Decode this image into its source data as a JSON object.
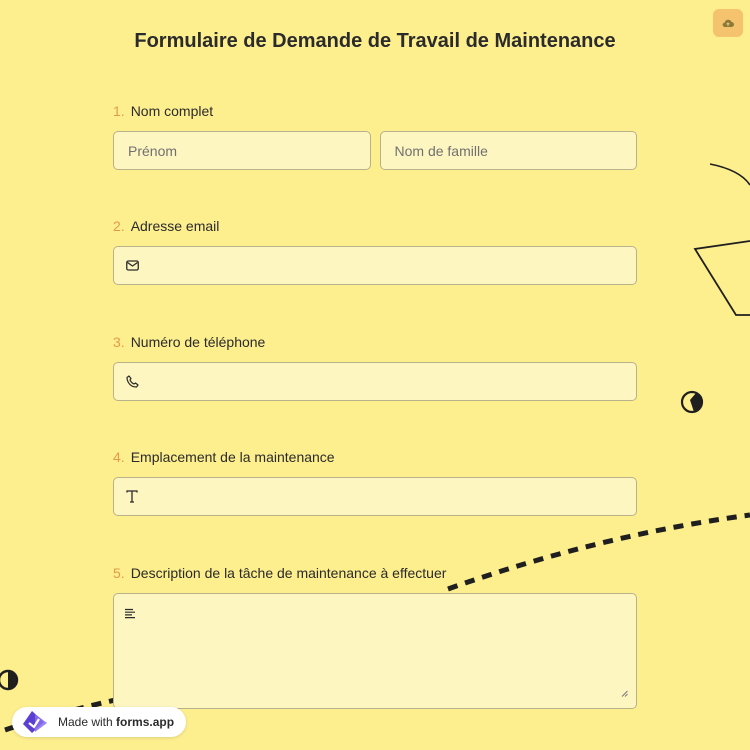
{
  "form": {
    "title": "Formulaire de Demande de Travail de Maintenance",
    "questions": [
      {
        "number": "1.",
        "label": "Nom complet",
        "first_placeholder": "Prénom",
        "last_placeholder": "Nom de famille"
      },
      {
        "number": "2.",
        "label": "Adresse email",
        "icon": "mail-icon"
      },
      {
        "number": "3.",
        "label": "Numéro de téléphone",
        "icon": "phone-icon"
      },
      {
        "number": "4.",
        "label": "Emplacement de la maintenance",
        "icon": "text-icon"
      },
      {
        "number": "5.",
        "label": "Description de la tâche de maintenance à effectuer",
        "icon": "paragraph-icon"
      }
    ]
  },
  "badge": {
    "prefix": "Made with",
    "brand": "forms.app"
  },
  "colors": {
    "background": "#fdee8e",
    "field_bg": "#fef6c1",
    "accent": "#e39c45",
    "save_button": "#f5c36e"
  }
}
